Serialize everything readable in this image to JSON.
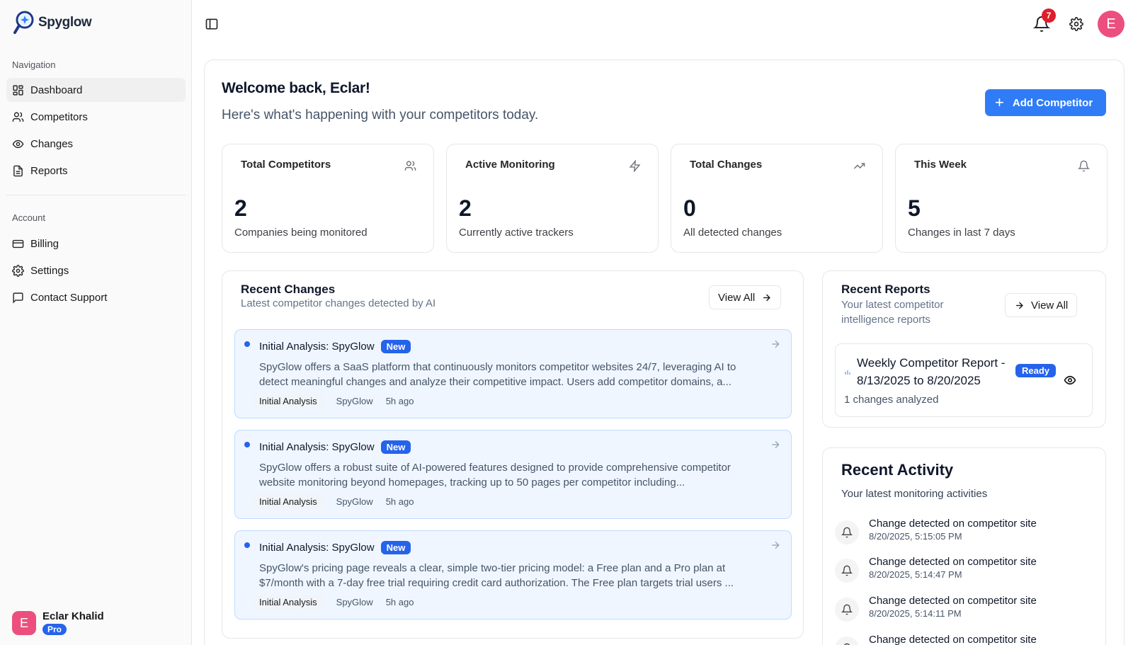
{
  "brand": {
    "name": "Spyglow"
  },
  "sidebar": {
    "nav_label": "Navigation",
    "nav_items": [
      {
        "label": "Dashboard",
        "icon": "dashboard-icon",
        "active": true
      },
      {
        "label": "Competitors",
        "icon": "users-icon"
      },
      {
        "label": "Changes",
        "icon": "eye-icon"
      },
      {
        "label": "Reports",
        "icon": "file-text-icon"
      }
    ],
    "account_label": "Account",
    "account_items": [
      {
        "label": "Billing",
        "icon": "credit-card-icon"
      },
      {
        "label": "Settings",
        "icon": "gear-icon"
      },
      {
        "label": "Contact Support",
        "icon": "message-square-icon"
      }
    ],
    "user": {
      "initial": "E",
      "name": "Eclar Khalid",
      "plan": "Pro"
    }
  },
  "topbar": {
    "notification_count": "7",
    "avatar_initial": "E"
  },
  "header": {
    "title": "Welcome back, Eclar!",
    "subtitle": "Here's what's happening with your competitors today.",
    "add_button": "Add Competitor"
  },
  "stats": [
    {
      "title": "Total Competitors",
      "value": "2",
      "caption": "Companies being monitored",
      "icon": "users-icon"
    },
    {
      "title": "Active Monitoring",
      "value": "2",
      "caption": "Currently active trackers",
      "icon": "zap-icon"
    },
    {
      "title": "Total Changes",
      "value": "0",
      "caption": "All detected changes",
      "icon": "trending-up-icon"
    },
    {
      "title": "This Week",
      "value": "5",
      "caption": "Changes in last 7 days",
      "icon": "bell-icon"
    }
  ],
  "recent_changes": {
    "title": "Recent Changes",
    "subtitle": "Latest competitor changes detected by AI",
    "view_all": "View All",
    "items": [
      {
        "title": "Initial Analysis: SpyGlow",
        "badge": "New",
        "description": "SpyGlow offers a SaaS platform that continuously monitors competitor websites 24/7, leveraging AI to detect meaningful changes and analyze their competitive impact. Users add competitor domains, a...",
        "type": "Initial Analysis",
        "competitor": "SpyGlow",
        "time": "5h ago"
      },
      {
        "title": "Initial Analysis: SpyGlow",
        "badge": "New",
        "description": "SpyGlow offers a robust suite of AI-powered features designed to provide comprehensive competitor website monitoring beyond homepages, tracking up to 50 pages per competitor including...",
        "type": "Initial Analysis",
        "competitor": "SpyGlow",
        "time": "5h ago"
      },
      {
        "title": "Initial Analysis: SpyGlow",
        "badge": "New",
        "description": "SpyGlow's pricing page reveals a clear, simple two-tier pricing model: a Free plan and a Pro plan at $7/month with a 7-day free trial requiring credit card authorization. The Free plan targets trial users ...",
        "type": "Initial Analysis",
        "competitor": "SpyGlow",
        "time": "5h ago"
      }
    ]
  },
  "recent_reports": {
    "title": "Recent Reports",
    "subtitle": "Your latest competitor intelligence reports",
    "view_all": "View All",
    "items": [
      {
        "title": "Weekly Competitor Report - 8/13/2025 to 8/20/2025",
        "status": "Ready",
        "meta": "1 changes analyzed"
      }
    ]
  },
  "recent_activity": {
    "title": "Recent Activity",
    "subtitle": "Your latest monitoring activities",
    "items": [
      {
        "text": "Change detected on competitor site",
        "time": "8/20/2025, 5:15:05 PM"
      },
      {
        "text": "Change detected on competitor site",
        "time": "8/20/2025, 5:14:47 PM"
      },
      {
        "text": "Change detected on competitor site",
        "time": "8/20/2025, 5:14:11 PM"
      },
      {
        "text": "Change detected on competitor site",
        "time": ""
      }
    ]
  },
  "colors": {
    "accent": "#2f7cf6",
    "badge_blue": "#2563eb",
    "avatar": "#ec4f7e",
    "notification": "#e11d2a"
  }
}
